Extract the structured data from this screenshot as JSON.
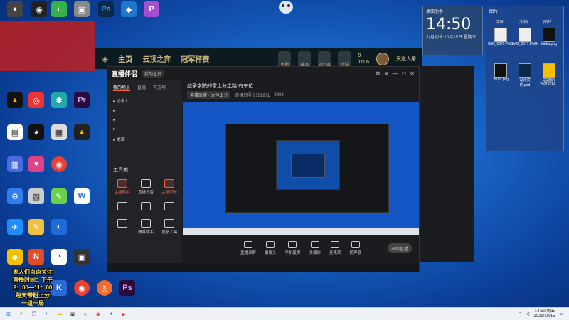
{
  "desktop": {
    "red_panel_lines": [
      "",
      "",
      "",
      "",
      "",
      "",
      ""
    ],
    "stream_overlay": [
      "家人们点点关注",
      "直播时间：下午",
      "2：00—11：00",
      "每天带粉上分",
      "一组一局"
    ]
  },
  "lol_client": {
    "nav": [
      "主页",
      "云顶之弈",
      "冠军杯赛"
    ],
    "right_buttons": [
      "主题",
      "藏品",
      "战利品",
      "商城"
    ],
    "currency": [
      "0",
      "1606"
    ],
    "player": "天道人屠"
  },
  "streamer_app": {
    "app_name": "直播伴侣",
    "badge": "我的主页",
    "left_tabs": [
      "我的场景",
      "直播",
      "可选项"
    ],
    "scenes": [
      "场景1",
      "",
      "",
      "",
      "桌面"
    ],
    "tools_title": "工具箱",
    "tools": [
      "主播助手",
      "直播设置",
      "主播回放",
      "",
      "",
      "",
      "",
      "弹幕助手",
      "更多工具"
    ],
    "stream_title": "战争学院的雷上分之路  有车位",
    "meta": [
      "英雄联盟 · 大神上分",
      "直播间号 9791971",
      "3206"
    ],
    "bottom_tools": [
      "直播录屏",
      "摄像头",
      "手机投屏",
      "多媒体",
      "麦克风",
      "扬声器"
    ],
    "live_button": "开始直播"
  },
  "clock_widget": {
    "title": "桌面助手",
    "time": "14:50",
    "date_line": "九月初十  10月15日  星期五"
  },
  "files_widget": {
    "title": "图片",
    "tabs": [
      "目录",
      "文档",
      "图片"
    ],
    "files": [
      "IMG_0079.PNG",
      "IMG_0077.PNG",
      "kafka.png",
      "zhutu.png",
      "设计文件.psd",
      "QQ图片20211014..."
    ]
  },
  "taskbar": {
    "time": "14:50 周五",
    "date": "2021/10/15"
  }
}
